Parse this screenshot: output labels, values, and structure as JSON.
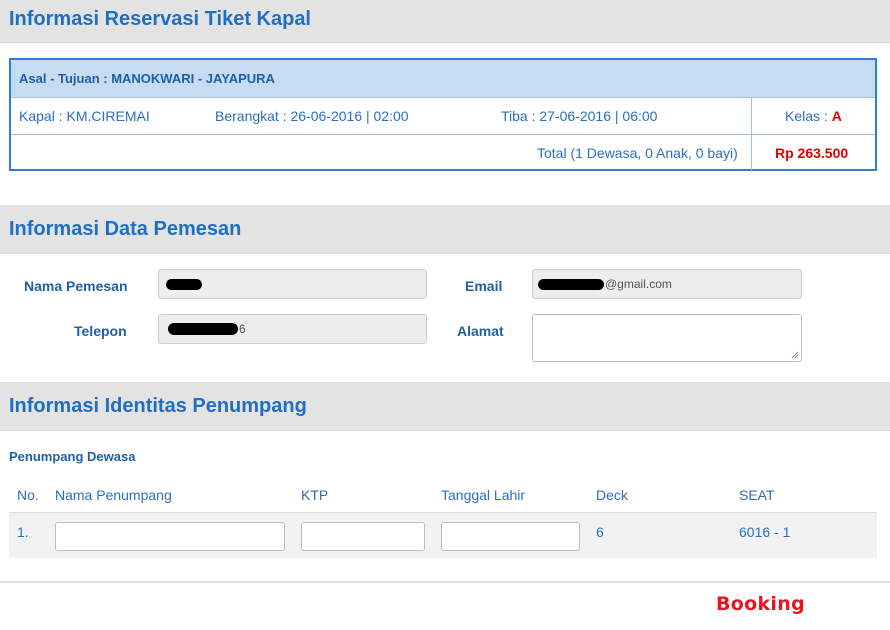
{
  "sections": {
    "reservation_title": "Informasi Reservasi Tiket Kapal",
    "orderer_title": "Informasi Data Pemesan",
    "passenger_title": "Informasi Identitas Penumpang"
  },
  "reservation": {
    "route": "Asal - Tujuan : MANOKWARI - JAYAPURA",
    "ship": "Kapal : KM.CIREMAI",
    "depart": "Berangkat : 26-06-2016 | 02:00",
    "arrive": "Tiba : 27-06-2016 | 06:00",
    "class_label": "Kelas : ",
    "class_value": "A",
    "total_label": "Total (1 Dewasa, 0 Anak, 0 bayi)",
    "total_value": "Rp 263.500"
  },
  "orderer": {
    "name_label": "Nama Pemesan",
    "phone_label": "Telepon",
    "email_label": "Email",
    "address_label": "Alamat",
    "email_value": "@gmail.com",
    "phone_value": "6"
  },
  "passengers": {
    "group_label": "Penumpang Dewasa",
    "columns": [
      "No.",
      "Nama Penumpang",
      "KTP",
      "Tanggal Lahir",
      "Deck",
      "SEAT"
    ],
    "rows": [
      {
        "no": "1.",
        "deck": "6",
        "seat": "6016 - 1"
      }
    ]
  },
  "actions": {
    "booking_label": "Booking"
  },
  "colors": {
    "accent": "#1e6fc4",
    "highlight": "#e00000"
  }
}
